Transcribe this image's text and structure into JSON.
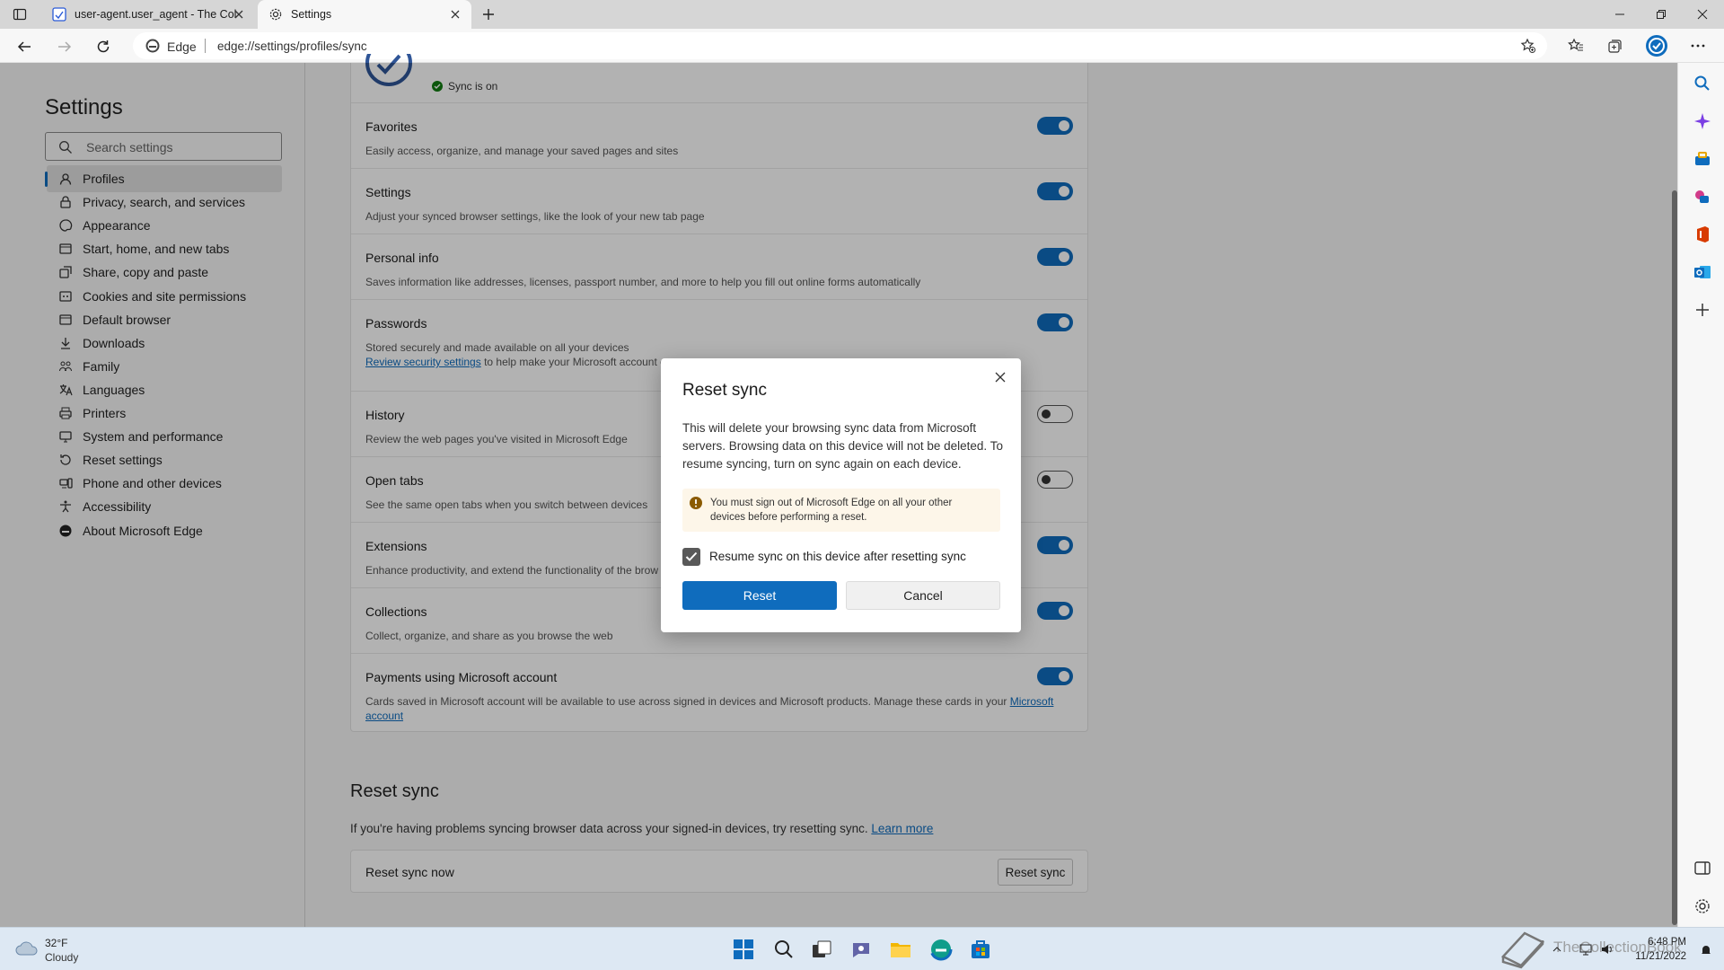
{
  "tabs": [
    {
      "title": "user-agent.user_agent - The Col",
      "active": false
    },
    {
      "title": "Settings",
      "active": true
    }
  ],
  "address_bar": {
    "site_label": "Edge",
    "url": "edge://settings/profiles/sync"
  },
  "nav": {
    "title": "Settings",
    "search_placeholder": "Search settings",
    "items": [
      {
        "label": "Profiles",
        "icon": "profile-icon",
        "active": true
      },
      {
        "label": "Privacy, search, and services",
        "icon": "lock-icon"
      },
      {
        "label": "Appearance",
        "icon": "palette-icon"
      },
      {
        "label": "Start, home, and new tabs",
        "icon": "home-icon"
      },
      {
        "label": "Share, copy and paste",
        "icon": "share-icon"
      },
      {
        "label": "Cookies and site permissions",
        "icon": "cookie-icon"
      },
      {
        "label": "Default browser",
        "icon": "browser-icon"
      },
      {
        "label": "Downloads",
        "icon": "download-icon"
      },
      {
        "label": "Family",
        "icon": "family-icon"
      },
      {
        "label": "Languages",
        "icon": "language-icon"
      },
      {
        "label": "Printers",
        "icon": "printer-icon"
      },
      {
        "label": "System and performance",
        "icon": "system-icon"
      },
      {
        "label": "Reset settings",
        "icon": "reset-icon"
      },
      {
        "label": "Phone and other devices",
        "icon": "phone-icon"
      },
      {
        "label": "Accessibility",
        "icon": "accessibility-icon"
      },
      {
        "label": "About Microsoft Edge",
        "icon": "edge-icon"
      }
    ]
  },
  "sync_status": "Sync is on",
  "sync_items": [
    {
      "title": "Favorites",
      "desc": "Easily access, organize, and manage your saved pages and sites",
      "on": true
    },
    {
      "title": "Settings",
      "desc": "Adjust your synced browser settings, like the look of your new tab page",
      "on": true
    },
    {
      "title": "Personal info",
      "desc": "Saves information like addresses, licenses, passport number, and more to help you fill out online forms automatically",
      "on": true
    },
    {
      "title": "Passwords",
      "desc": "Stored securely and made available on all your devices",
      "link": "Review security settings",
      "desc2": "to help make your Microsoft account e",
      "on": true
    },
    {
      "title": "History",
      "desc": "Review the web pages you've visited in Microsoft Edge",
      "on": false
    },
    {
      "title": "Open tabs",
      "desc": "See the same open tabs when you switch between devices",
      "on": false
    },
    {
      "title": "Extensions",
      "desc": "Enhance productivity, and extend the functionality of the brow",
      "on": true
    },
    {
      "title": "Collections",
      "desc": "Collect, organize, and share as you browse the web",
      "on": true
    },
    {
      "title": "Payments using Microsoft account",
      "desc": "Cards saved in Microsoft account will be available to use across signed in devices and Microsoft products. Manage these cards in your",
      "link": "Microsoft",
      "link2": "account",
      "on": true
    }
  ],
  "reset_section": {
    "heading": "Reset sync",
    "desc": "If you're having problems syncing browser data across your signed-in devices, try resetting sync.",
    "learn_more": "Learn more",
    "row_label": "Reset sync now",
    "button": "Reset sync"
  },
  "dialog": {
    "title": "Reset sync",
    "body": "This will delete your browsing sync data from Microsoft servers. Browsing data on this device will not be deleted. To resume syncing, turn on sync again on each device.",
    "warning": "You must sign out of Microsoft Edge on all your other devices before performing a reset.",
    "checkbox_label": "Resume sync on this device after resetting sync",
    "checkbox_checked": true,
    "primary": "Reset",
    "secondary": "Cancel"
  },
  "taskbar": {
    "temperature": "32°F",
    "condition": "Cloudy",
    "time": "6:48 PM",
    "date": "11/21/2022",
    "watermark": "TheCollectionBook"
  },
  "colors": {
    "accent": "#0f6cbd",
    "warning_bg": "#fdf6e9",
    "warning_icon": "#8a5a00",
    "sync_ok": "#107c10"
  }
}
